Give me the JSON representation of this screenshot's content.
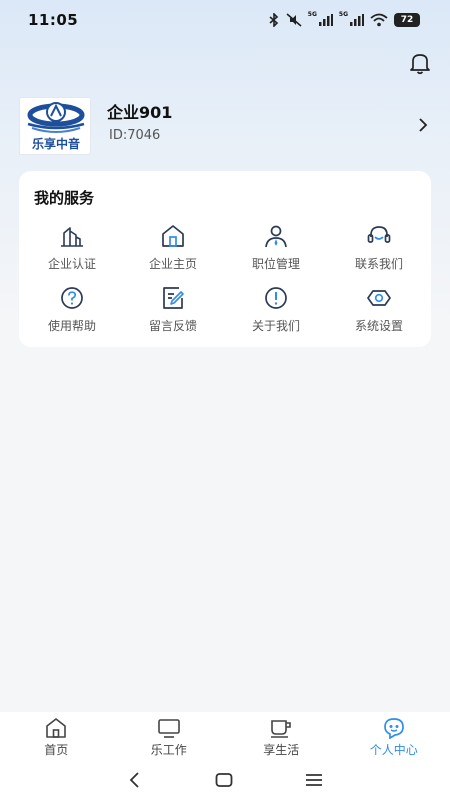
{
  "status_bar": {
    "time": "11:05",
    "battery": "72",
    "signal_label": "5G",
    "icons": [
      "bluetooth-icon",
      "mute-icon",
      "signal-icon",
      "signal-icon",
      "wifi-icon",
      "battery-icon"
    ]
  },
  "header": {
    "bell_icon": "bell-icon"
  },
  "profile": {
    "logo_text": "乐享中音",
    "name": "企业901",
    "id": "ID:7046",
    "chevron_icon": "chevron-right-icon"
  },
  "services": {
    "title": "我的服务",
    "items": [
      {
        "label": "企业认证",
        "icon": "buildings-icon"
      },
      {
        "label": "企业主页",
        "icon": "home-icon"
      },
      {
        "label": "职位管理",
        "icon": "user-tie-icon"
      },
      {
        "label": "联系我们",
        "icon": "headset-icon"
      },
      {
        "label": "使用帮助",
        "icon": "help-icon"
      },
      {
        "label": "留言反馈",
        "icon": "edit-note-icon"
      },
      {
        "label": "关于我们",
        "icon": "info-icon"
      },
      {
        "label": "系统设置",
        "icon": "settings-icon"
      }
    ]
  },
  "bottom_nav": {
    "items": [
      {
        "label": "首页",
        "icon": "home-icon"
      },
      {
        "label": "乐工作",
        "icon": "monitor-icon"
      },
      {
        "label": "享生活",
        "icon": "cup-icon"
      },
      {
        "label": "个人中心",
        "icon": "robot-icon"
      }
    ],
    "active_index": 3
  },
  "colors": {
    "accent": "#2f8ee8",
    "icon": "#2b3a55",
    "label": "#555555"
  }
}
